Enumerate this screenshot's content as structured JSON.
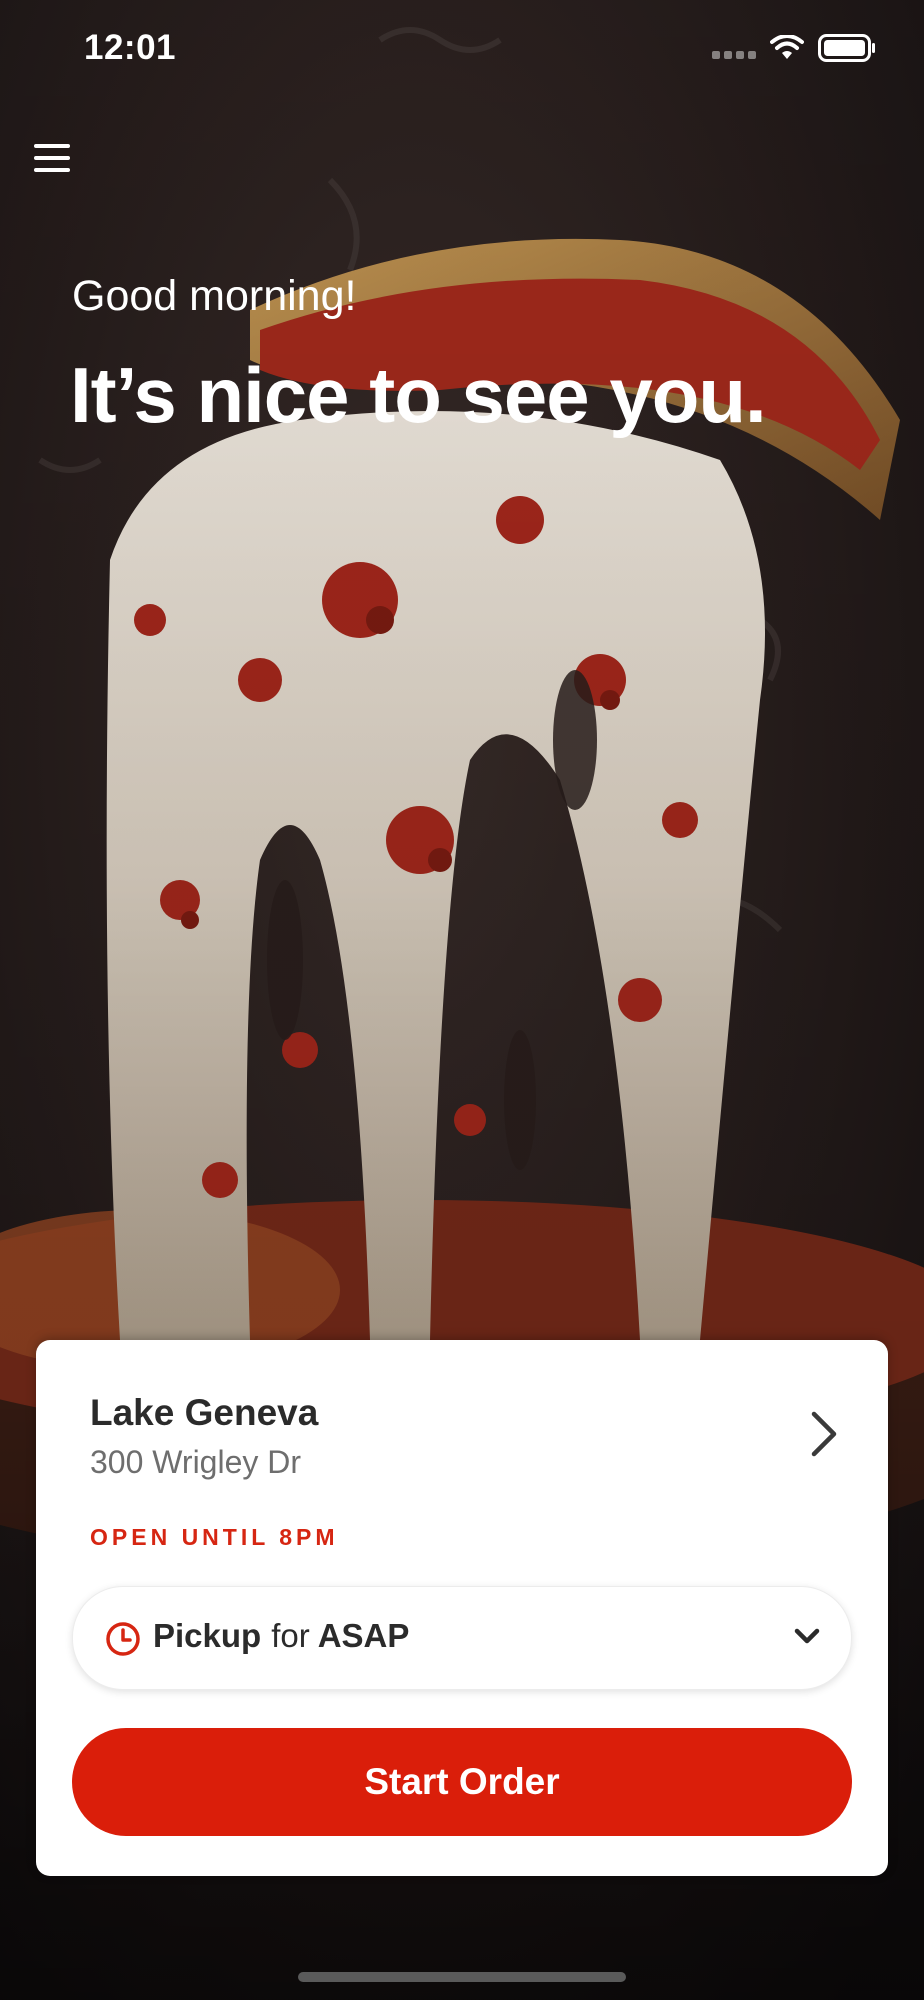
{
  "status_bar": {
    "time": "12:01"
  },
  "hero": {
    "greeting": "Good morning!",
    "headline": "It’s nice to see you."
  },
  "location": {
    "name": "Lake Geneva",
    "address": "300 Wrigley Dr",
    "hours_status": "OPEN UNTIL 8PM"
  },
  "order_mode": {
    "method": "Pickup",
    "connector": "for",
    "time": "ASAP"
  },
  "actions": {
    "start_order_label": "Start Order"
  },
  "colors": {
    "accent": "#da1e0a",
    "status_text": "#d62612",
    "card_background": "#ffffff",
    "title_text": "#2b2b2b",
    "secondary_text": "#6e6e6e"
  }
}
